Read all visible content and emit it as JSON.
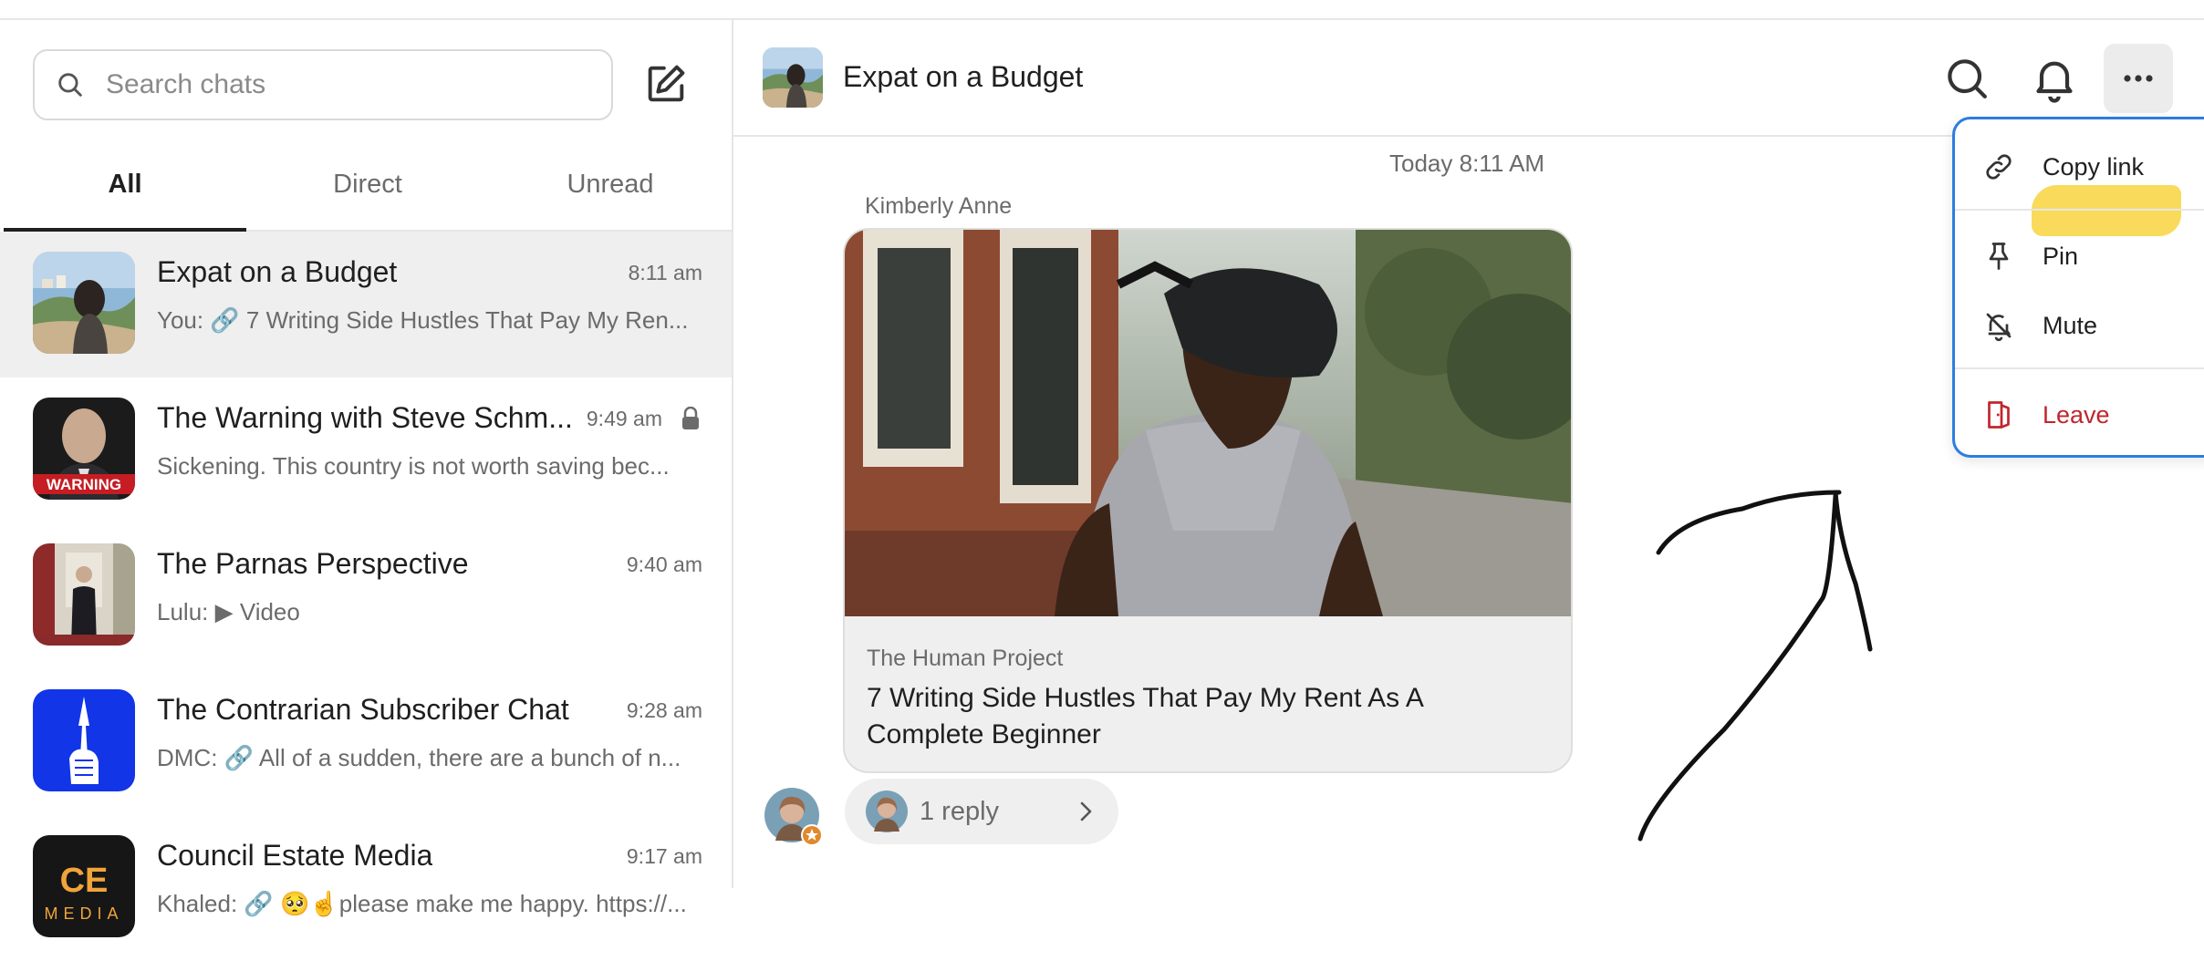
{
  "sidebar": {
    "search_placeholder": "Search chats",
    "tabs": [
      {
        "label": "All",
        "active": true
      },
      {
        "label": "Direct",
        "active": false
      },
      {
        "label": "Unread",
        "active": false
      }
    ],
    "chats": [
      {
        "title": "Expat on a Budget",
        "time": "8:11 am",
        "preview": "You: 🔗 7 Writing Side Hustles That Pay My Ren...",
        "locked": false,
        "selected": true
      },
      {
        "title": "The Warning with Steve Schm...",
        "time": "9:49 am",
        "preview": "Sickening. This country is not worth saving bec...",
        "locked": true,
        "selected": false
      },
      {
        "title": "The Parnas Perspective",
        "time": "9:40 am",
        "preview": "Lulu: ▶ Video",
        "locked": false,
        "selected": false
      },
      {
        "title": "The Contrarian Subscriber Chat",
        "time": "9:28 am",
        "preview": "DMC: 🔗 All of a sudden, there are a bunch of n...",
        "locked": false,
        "selected": false
      },
      {
        "title": "Council Estate Media",
        "time": "9:17 am",
        "preview": "Khaled: 🔗 🥺☝️please make me happy. https://...",
        "locked": false,
        "selected": false
      }
    ],
    "avatar_text": {
      "warning": "WARNING",
      "ce": "CE",
      "media": "MEDIA"
    }
  },
  "conversation": {
    "title": "Expat on a Budget",
    "timestamp": "Today 8:11 AM",
    "sender": "Kimberly Anne",
    "post": {
      "source": "The Human Project",
      "title": "7 Writing Side Hustles That Pay My Rent As A Complete Beginner"
    },
    "reply_label": "1 reply"
  },
  "menu": {
    "items": [
      {
        "label": "Copy link",
        "icon": "link-icon"
      },
      {
        "label": "Pin",
        "icon": "pin-icon"
      },
      {
        "label": "Mute",
        "icon": "bell-off-icon"
      },
      {
        "label": "Leave",
        "icon": "door-icon",
        "danger": true
      }
    ]
  },
  "colors": {
    "accent": "#2c7de0",
    "danger": "#c0262d",
    "highlight": "#f8d648",
    "selected_row": "#efefef"
  }
}
